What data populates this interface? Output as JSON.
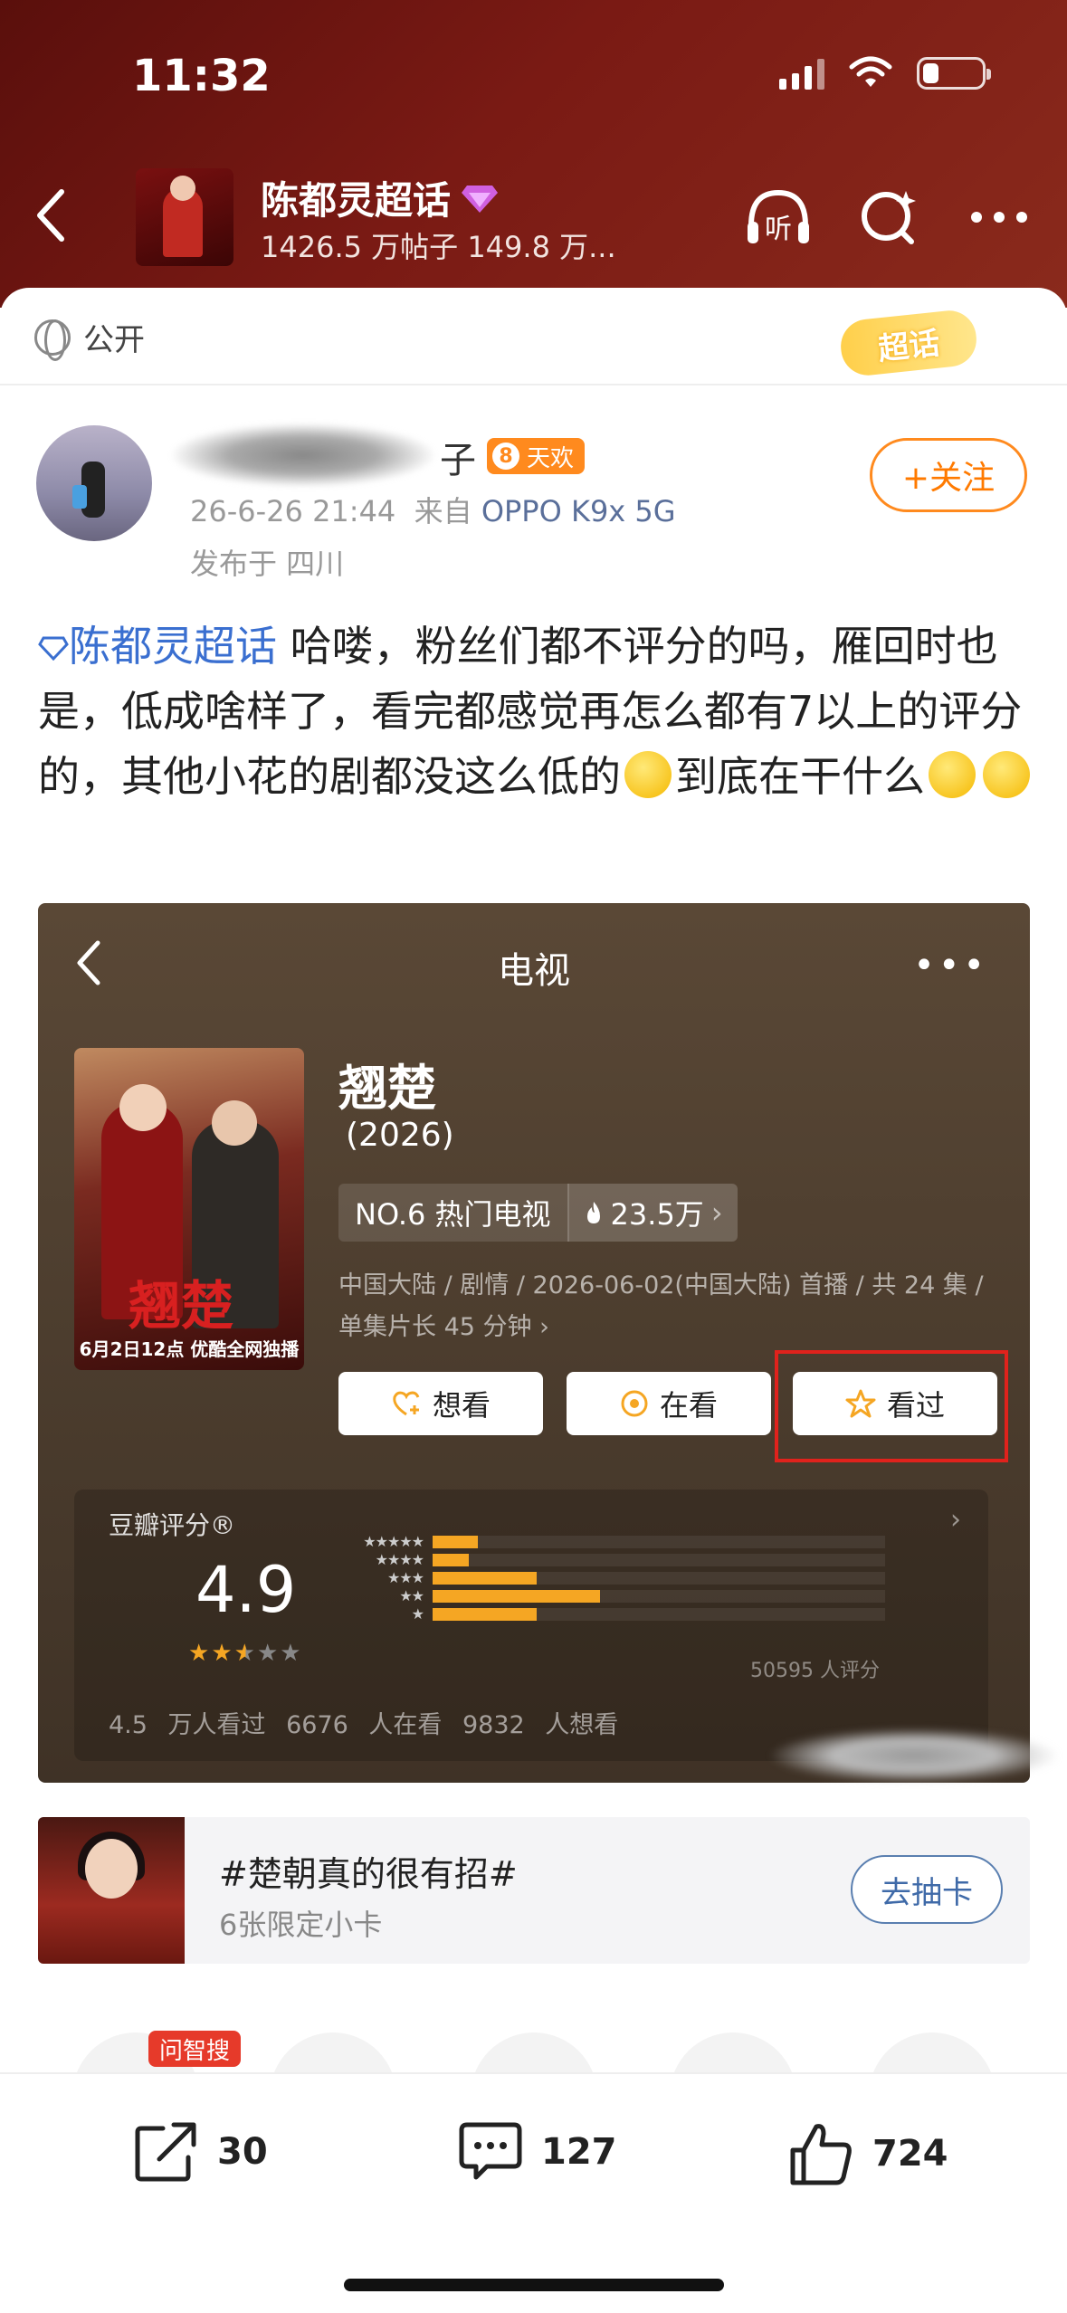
{
  "status_bar": {
    "time": "11:32",
    "battery_level": 0.28
  },
  "header": {
    "topic_title": "陈都灵超话",
    "topic_stats": "1426.5 万帖子 149.8 万...",
    "listen_label": "听"
  },
  "post": {
    "visibility": "公开",
    "chaohua_badge": "超话",
    "username_tail": "子",
    "level": "8",
    "level_title": "天欢",
    "time": "26-6-26 21:44",
    "source_prefix": "来自",
    "device": "OPPO K9x 5G",
    "location": "发布于 四川",
    "follow_label": "+关注",
    "topic_link": "陈都灵超话",
    "text_1": " 哈喽，粉丝们都不评分的吗，雁回时也是，低成啥样了，看完都感觉再怎么都有7以上的评分的，其他小花的剧都没这么低的",
    "text_2": "到底在干什么"
  },
  "screenshot": {
    "page_title": "电视",
    "show_name": "翘楚",
    "show_year": "(2026)",
    "rank": "NO.6 热门电视",
    "heat": "23.5万",
    "info": "中国大陆 / 剧情 / 2026-06-02(中国大陆) 首播 / 共 24 集 / 单集片长 45 分钟",
    "poster_caption": "6月2日12点 优酷全网独播",
    "poster_title": "翘楚",
    "actions": [
      {
        "label": "想看"
      },
      {
        "label": "在看"
      },
      {
        "label": "看过"
      }
    ],
    "rating": {
      "label": "豆瓣评分®",
      "score": "4.9",
      "stars": 2.5,
      "distribution": [
        {
          "stars": "★★★★★",
          "fraction": 0.1
        },
        {
          "stars": "★★★★",
          "fraction": 0.08
        },
        {
          "stars": "★★★",
          "fraction": 0.23
        },
        {
          "stars": "★★",
          "fraction": 0.37
        },
        {
          "stars": "★",
          "fraction": 0.23
        }
      ],
      "count": "50595 人评分",
      "summary": "4.5 万人看过 6676 人在看 9832 人想看"
    }
  },
  "related": {
    "title": "#楚朝真的很有招#",
    "subtitle": "6张限定小卡",
    "button": "去抽卡"
  },
  "ai_tag": "问智搜",
  "bottom_bar": {
    "share_count": "30",
    "comment_count": "127",
    "like_count": "724"
  }
}
